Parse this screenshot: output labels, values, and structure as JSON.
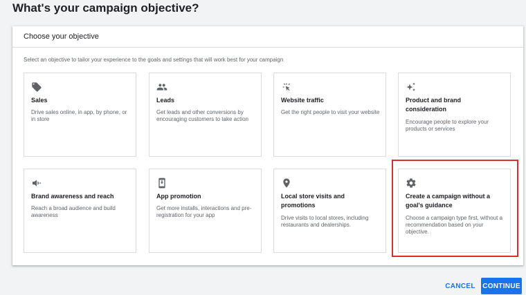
{
  "page": {
    "title": "What's your campaign objective?"
  },
  "card": {
    "header": "Choose your objective",
    "instructions": "Select an objective to tailor your experience to the goals and settings that will work best for your campaign"
  },
  "objectives": [
    {
      "icon": "tag-icon",
      "title": "Sales",
      "desc": "Drive sales online, in app, by phone, or in store"
    },
    {
      "icon": "people-icon",
      "title": "Leads",
      "desc": "Get leads and other conversions by encouraging customers to take action"
    },
    {
      "icon": "cursor-click-icon",
      "title": "Website traffic",
      "desc": "Get the right people to visit your website"
    },
    {
      "icon": "sparkle-icon",
      "title": "Product and brand consideration",
      "desc": "Encourage people to explore your products or services"
    },
    {
      "icon": "megaphone-icon",
      "title": "Brand awareness and reach",
      "desc": "Reach a broad audience and build awareness"
    },
    {
      "icon": "phone-download-icon",
      "title": "App promotion",
      "desc": "Get more installs, interactions and pre-registration for your app"
    },
    {
      "icon": "location-pin-icon",
      "title": "Local store visits and promotions",
      "desc": "Drive visits to local stores, including restaurants and dealerships."
    },
    {
      "icon": "gear-icon",
      "title": "Create a campaign without a goal's guidance",
      "desc": "Choose a campaign type first, without a recommendation based on your objective."
    }
  ],
  "actions": {
    "cancel": "CANCEL",
    "continue": "CONTINUE"
  },
  "colors": {
    "accent": "#1a73e8",
    "highlight": "#d93025",
    "icon": "#5f6368"
  }
}
